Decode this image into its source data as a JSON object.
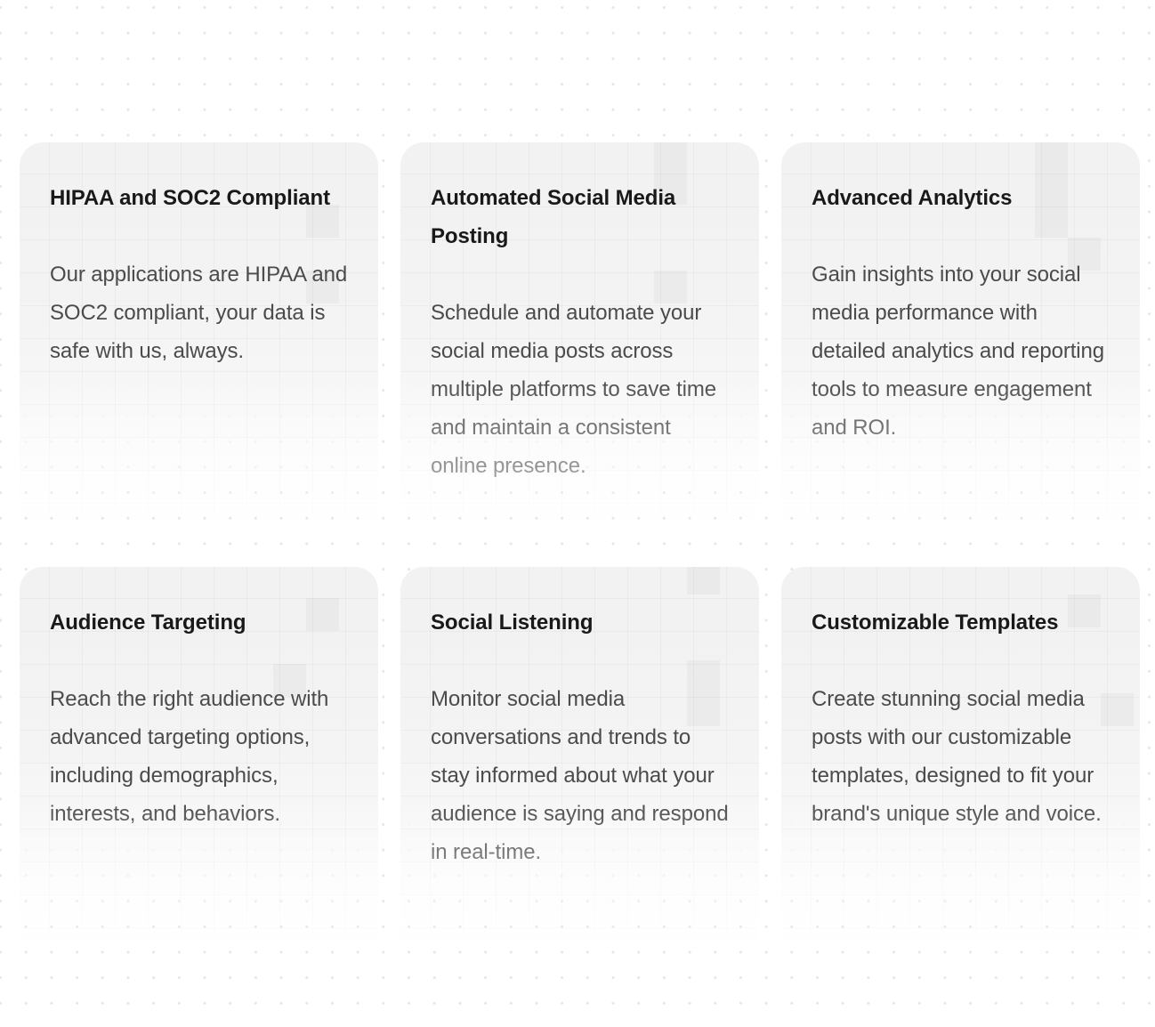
{
  "page": {
    "background_color": "#ffffff",
    "dot_color": "#e6e6e6",
    "card_background_color": "#f2f2f2",
    "heading_color": "#19191b",
    "body_color": "#4b4b4d"
  },
  "features": [
    {
      "title": "HIPAA and SOC2 Compliant",
      "description": "Our applications are HIPAA and SOC2 compliant, your data is safe with us, always."
    },
    {
      "title": "Automated Social Media Posting",
      "description": "Schedule and automate your social media posts across multiple platforms to save time and maintain a consistent online presence."
    },
    {
      "title": "Advanced Analytics",
      "description": "Gain insights into your social media performance with detailed analytics and reporting tools to measure engagement and ROI."
    },
    {
      "title": "Audience Targeting",
      "description": "Reach the right audience with advanced targeting options, including demographics, interests, and behaviors."
    },
    {
      "title": "Social Listening",
      "description": "Monitor social media conversations and trends to stay informed about what your audience is saying and respond in real-time."
    },
    {
      "title": "Customizable Templates",
      "description": "Create stunning social media posts with our customizable templates, designed to fit your brand's unique style and voice."
    }
  ]
}
